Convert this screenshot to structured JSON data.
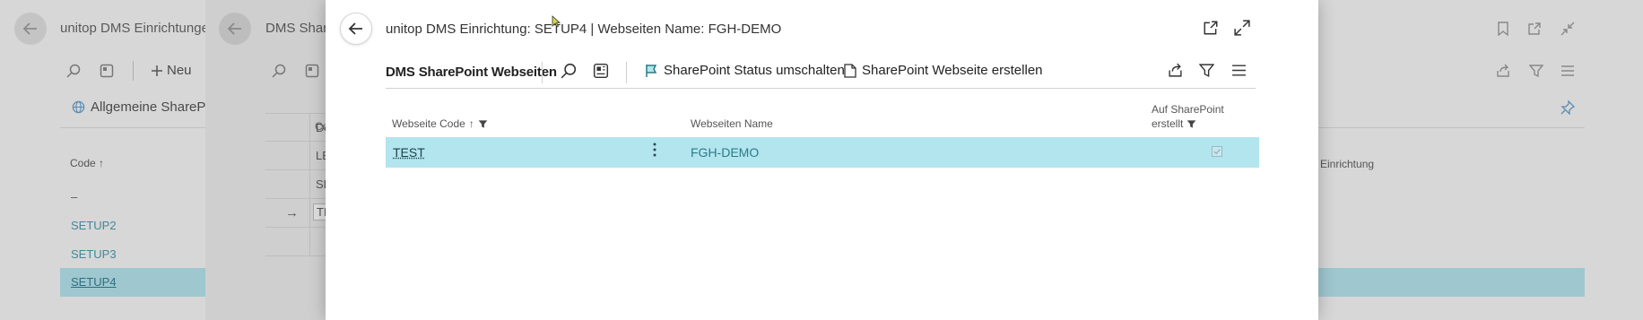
{
  "background_page": {
    "title": "unitop DMS Einrichtungen",
    "new_label": "Neu",
    "general_label": "Allgemeine SharePoint",
    "column_code": "Code",
    "column_einrichtung": "Einrichtung",
    "rows": [
      "–",
      "SETUP2",
      "SETUP3",
      "SETUP4"
    ],
    "selected_row": "SETUP4"
  },
  "middle_page": {
    "title": "DMS Share",
    "column_code": "Co",
    "rows": [
      "De",
      "LE",
      "SF",
      "TE"
    ]
  },
  "dialog": {
    "title": "unitop DMS Einrichtung: SETUP4 | Webseiten Name: FGH-DEMO",
    "toolbar": {
      "page_title": "DMS SharePoint Webseiten",
      "action_toggle_status": "SharePoint Status umschalten",
      "action_create_site": "SharePoint Webseite erstellen"
    },
    "columns": {
      "code": "Webseite Code",
      "name": "Webseiten Name",
      "created_line1": "Auf SharePoint",
      "created_line2": "erstellt"
    },
    "rows": [
      {
        "code": "TEST",
        "name": "FGH-DEMO",
        "created": true
      }
    ]
  },
  "colors": {
    "selected_row": "#b3e5ee",
    "accent": "#2a7b88"
  },
  "icons": [
    "back-arrow-icon",
    "search-icon",
    "view-icon",
    "flag-icon",
    "page-icon",
    "share-icon",
    "filter-icon",
    "list-icon",
    "popout-icon",
    "expand-icon",
    "more-vertical-icon",
    "pin-icon",
    "bookmark-icon",
    "collapse-icon"
  ]
}
